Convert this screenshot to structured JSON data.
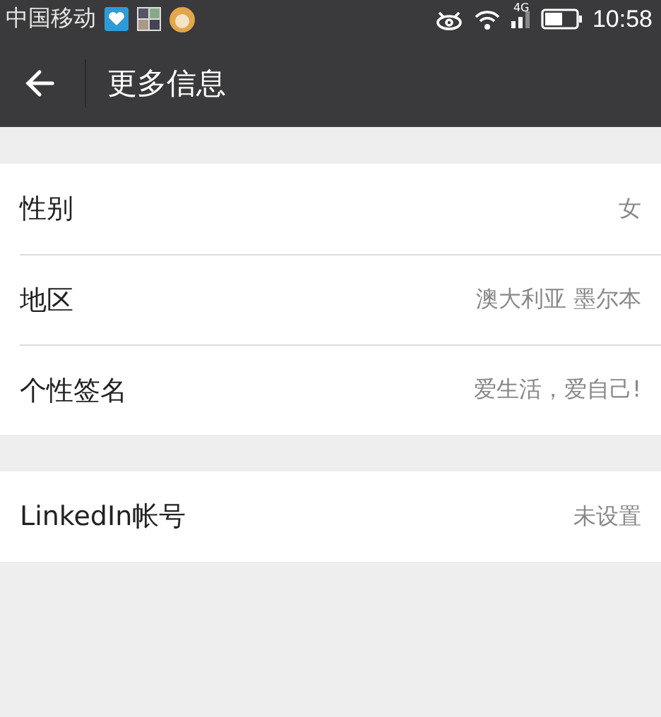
{
  "status_bar": {
    "carrier": "中国移动",
    "network": "4G",
    "time": "10:58"
  },
  "app_bar": {
    "title": "更多信息"
  },
  "groups": [
    {
      "rows": [
        {
          "label": "性别",
          "value": "女"
        },
        {
          "label": "地区",
          "value": "澳大利亚 墨尔本"
        },
        {
          "label": "个性签名",
          "value": "爱生活，爱自己!"
        }
      ]
    },
    {
      "rows": [
        {
          "label": "LinkedIn帐号",
          "value": "未设置"
        }
      ]
    }
  ]
}
